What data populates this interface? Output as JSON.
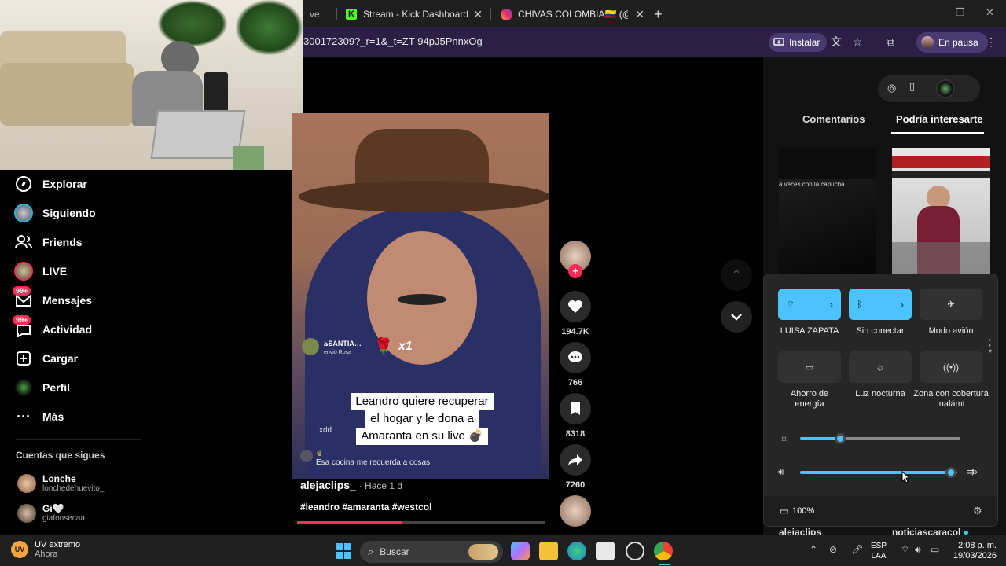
{
  "browser": {
    "tabs": [
      {
        "label": "Stream - Kick Dashboard",
        "icon": "kick-icon"
      },
      {
        "label": "CHIVAS COLOMBIA🇨🇴 (@chiva",
        "icon": "instagram-icon"
      }
    ],
    "partial_tab_label": "ve",
    "url": "300172309?_r=1&_t=ZT-94pJ5PnnxOg",
    "install_label": "Instalar",
    "profile_label": "En pausa"
  },
  "sidebar": {
    "items": [
      {
        "label": "Explorar",
        "icon": "compass-icon"
      },
      {
        "label": "Siguiendo",
        "icon": "following-avatar-icon"
      },
      {
        "label": "Friends",
        "icon": "friends-icon"
      },
      {
        "label": "LIVE",
        "icon": "live-avatar-icon"
      },
      {
        "label": "Mensajes",
        "icon": "messages-icon",
        "badge": "99+"
      },
      {
        "label": "Actividad",
        "icon": "activity-icon",
        "badge": "99+"
      },
      {
        "label": "Cargar",
        "icon": "upload-icon"
      },
      {
        "label": "Perfil",
        "icon": "profile-icon"
      },
      {
        "label": "Más",
        "icon": "more-icon"
      }
    ],
    "following_heading": "Cuentas que sigues",
    "accounts": [
      {
        "name": "Lonche",
        "user": "lonchedehuevito_"
      },
      {
        "name": "Gi🤍",
        "user": "giafonsecaa"
      }
    ]
  },
  "video": {
    "gift_user": "ঌSANTIA…",
    "gift_sub": "envió Rosa",
    "gift_count": "x1",
    "chat_user": "xdd",
    "chat_msg": "Esa cocina me recuerda a cosas",
    "caption_lines": [
      "Leandro quiere recuperar",
      "el hogar y le dona a",
      "Amaranta en su live 💣"
    ],
    "author": "alejaclips_",
    "time": "· Hace 1 d",
    "hashtags": "#leandro #amaranta #westcol",
    "progress": 0.42
  },
  "actions": {
    "likes": "194.7K",
    "comments": "766",
    "saves": "8318",
    "shares": "7260"
  },
  "right_panel": {
    "tabs": [
      "Comentarios",
      "Podría interesarte"
    ],
    "thumb_text": "a veces con la capucha",
    "bottom_user_1": "alejaclips",
    "bottom_user_2": "noticiascaracol"
  },
  "quick_settings": {
    "tiles": [
      {
        "label": "LUISA ZAPATA",
        "icon": "wifi-icon",
        "on": true
      },
      {
        "label": "Sin conectar",
        "icon": "bluetooth-icon",
        "on": true
      },
      {
        "label": "Modo avión",
        "icon": "airplane-icon",
        "on": false
      },
      {
        "label": "Ahorro de energía",
        "icon": "battery-saver-icon",
        "on": false
      },
      {
        "label": "Luz nocturna",
        "icon": "night-light-icon",
        "on": false
      },
      {
        "label": "Zona con cobertura inalámt",
        "icon": "hotspot-icon",
        "on": false
      }
    ],
    "brightness": 0.25,
    "volume": 0.96,
    "battery": "100%"
  },
  "taskbar": {
    "weather_title": "UV extremo",
    "weather_sub": "Ahora",
    "weather_badge": "UV",
    "search_placeholder": "Buscar",
    "lang_1": "ESP",
    "lang_2": "LAA",
    "time": "2:08 p. m.",
    "date": "19/03/2026"
  },
  "colors": {
    "accent": "#4cc2ff",
    "tiktok_red": "#fe2c55",
    "address_bar": "#2b1f45"
  }
}
